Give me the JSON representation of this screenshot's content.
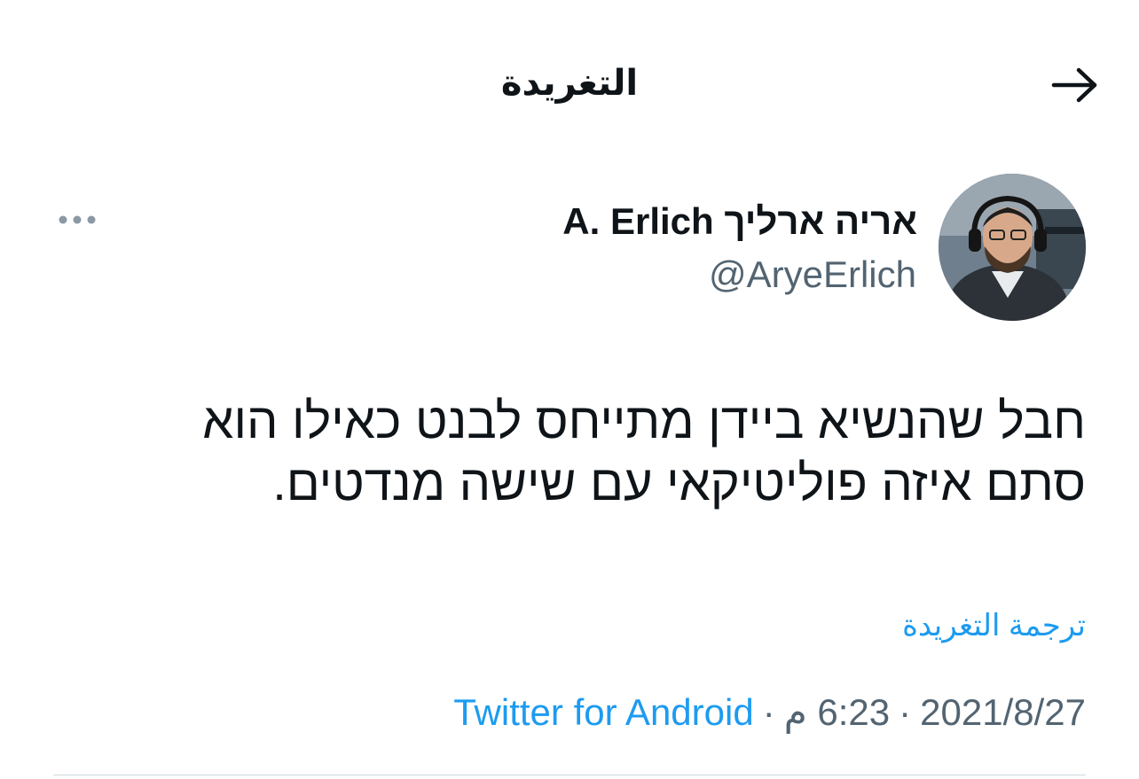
{
  "header": {
    "title": "التغريدة",
    "back_icon": "arrow-right-icon"
  },
  "author": {
    "name": "אריה ארליך A. Erlich",
    "handle": "@AryeErlich",
    "avatar_icon": "avatar-photo"
  },
  "more_icon": "more-dots-icon",
  "tweet": {
    "text": "חבל שהנשיא ביידן מתייחס לבנט כאילו הוא סתם איזה פוליטיקאי עם שישה מנדטים."
  },
  "translate_label": "ترجمة التغريدة",
  "meta": {
    "date": "2021/8/27",
    "time": "6:23 م",
    "separator": "·",
    "source": "Twitter for Android"
  },
  "colors": {
    "accent": "#1d9bf0",
    "text": "#0f1419",
    "muted": "#536471",
    "divider": "#cfd9de"
  }
}
